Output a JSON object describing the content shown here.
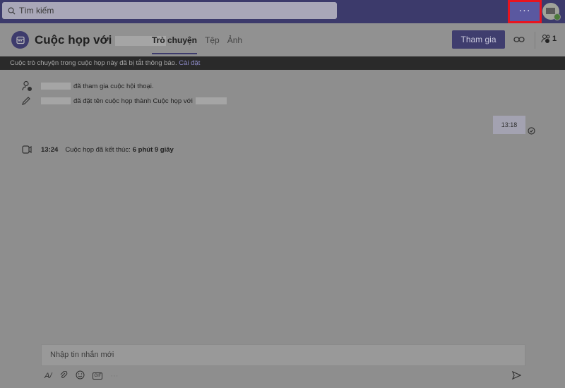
{
  "topbar": {
    "search_placeholder": "Tìm kiếm",
    "more_label": "···"
  },
  "header": {
    "title": "Cuộc họp với",
    "tabs": [
      {
        "label": "Trò chuyện"
      },
      {
        "label": "Tệp"
      },
      {
        "label": "Ảnh"
      }
    ],
    "join_label": "Tham gia",
    "participant_count": "1"
  },
  "banner": {
    "text": "Cuộc trò chuyện trong cuộc họp này đã bị tắt thông báo.",
    "link": "Cài đặt"
  },
  "events": [
    {
      "text": "đã tham gia cuộc hội thoại."
    },
    {
      "text": "đã đặt tên cuộc họp thành Cuộc họp với"
    },
    {
      "time": "13:24",
      "text": "Cuộc họp đã kết thúc:",
      "duration": "6 phút 9 giây"
    }
  ],
  "message": {
    "time": "13:18"
  },
  "compose": {
    "placeholder": "Nhập tin nhắn mới",
    "gif_label": "GIF",
    "more_label": "···"
  }
}
